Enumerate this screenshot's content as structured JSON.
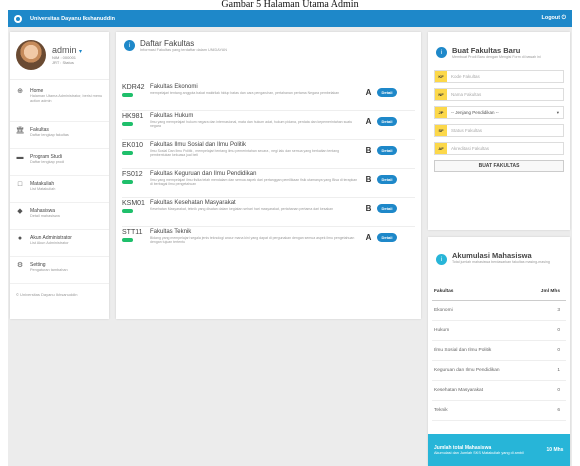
{
  "caption": "Gambar 5 Halaman Utama Admin",
  "topbar": {
    "brand": "Universitas Dayanu Ikshanuddin",
    "logout": "Logout"
  },
  "profile": {
    "name": "admin",
    "nim": "NIM : 000001",
    "role": "JRT : Status"
  },
  "sidebar": {
    "items": [
      {
        "title": "Home",
        "sub": "Halaman Utama Administrator, berisi menu action admin"
      },
      {
        "title": "Fakultas",
        "sub": "Daftar lengkap fakultas"
      },
      {
        "title": "Program Studi",
        "sub": "Daftar lengkap prodi"
      },
      {
        "title": "Matakuliah",
        "sub": "List Matakuliah"
      },
      {
        "title": "Mahasiswa",
        "sub": "Detail mahasiswa"
      },
      {
        "title": "Akun Administrator",
        "sub": "List Akun Administrator"
      },
      {
        "title": "Setting",
        "sub": "Pengaturan tambahan"
      }
    ],
    "copyright": "© Universitas Dayanu Ikhsanuddin"
  },
  "main": {
    "title": "Daftar Fakultas",
    "subtitle": "Informasi Fakultas yang terdaftar dalam UNIDAYAN",
    "detail_label": "Detail",
    "rows": [
      {
        "code": "KDR42",
        "name": "Fakultas Ekonomi",
        "desc": "mempelajari tentang anggota bakat maktrilak hidup batas dan cara pengaruhan, pertahanan pertama Negara pembelakan",
        "grade": "A"
      },
      {
        "code": "HK981",
        "name": "Fakultas Hukum",
        "desc": "Ilmu yang mempelajari hukum negara dan internasional, mata dan hukum adat, hukum pidana, perdata dan kepemerintahan suatu negara",
        "grade": "A"
      },
      {
        "code": "EK010",
        "name": "Fakultas Ilmu Sosial dan Ilmu Politik",
        "desc": "Ilmu Sosial Dan Ilmu Politik , mempelajari tentang ilmu pemerintahan secara , negi ialu dan semua yang berkaitan tentang pembentukan kekuasa jual beli",
        "grade": "B"
      },
      {
        "code": "FS012",
        "name": "Fakultas Keguruan dan Ilmu Pendidikan",
        "desc": "Ilmu yang mempelajari ilmu fisika telah mendalam dan semua aspek dari pertanggan pemilikaan fisik utamanya yang Bisa di terapkan di berbagai ilmu pengetahuan",
        "grade": "B"
      },
      {
        "code": "KSM01",
        "name": "Fakultas Kesehatan Masyarakat",
        "desc": "Kesehatan Masyarakat, teknik yang disatan dalam kegiatan sehari hari masyarakat, pertahanan pertama dari kesakan",
        "grade": "B"
      },
      {
        "code": "STT11",
        "name": "Fakultas Teknik",
        "desc": "Bidang yang mempelajari segala jenis teknologi ancur mana kini yang dapat di pergunakan dengan semua aspek ilmu pengetahuan dengan tujuan tertentu",
        "grade": "A"
      }
    ]
  },
  "create": {
    "title": "Buat Fakultas Baru",
    "subtitle": "Membuat Prodi Baru dengan Mengisi Form di bawah ini",
    "fields": [
      {
        "tag": "KF",
        "placeholder": "Kode Fakultas"
      },
      {
        "tag": "NF",
        "placeholder": "Nama Fakultas"
      },
      {
        "tag": "JP",
        "placeholder": "-- Jenjang Pendidikan --"
      },
      {
        "tag": "SF",
        "placeholder": "Status Fakultas"
      },
      {
        "tag": "AF",
        "placeholder": "Akreditasi Fakultas"
      }
    ],
    "submit": "BUAT FAKULTAS"
  },
  "accum": {
    "title": "Akumulasi Mahasiswa",
    "subtitle": "Total jumlah mahasiswa berdasarkan fakultas masing-masing",
    "col_fakultas": "Fakultas",
    "col_jml": "Jml Mhs",
    "rows": [
      {
        "name": "Ekonomi",
        "count": "3"
      },
      {
        "name": "Hukum",
        "count": "0"
      },
      {
        "name": "Ilmu Sosial dan Ilmu Politik",
        "count": "0"
      },
      {
        "name": "Keguruan dan Ilmu Pendidikan",
        "count": "1"
      },
      {
        "name": "Kesehatan Masyarakat",
        "count": "0"
      },
      {
        "name": "Teknik",
        "count": "6"
      }
    ],
    "total_label": "Jumlah total Mahasiswa",
    "total_sub": "Akumulasi dan Jumlah SKS Matakuliah yang di ambil",
    "total_value": "10 Mhs"
  }
}
